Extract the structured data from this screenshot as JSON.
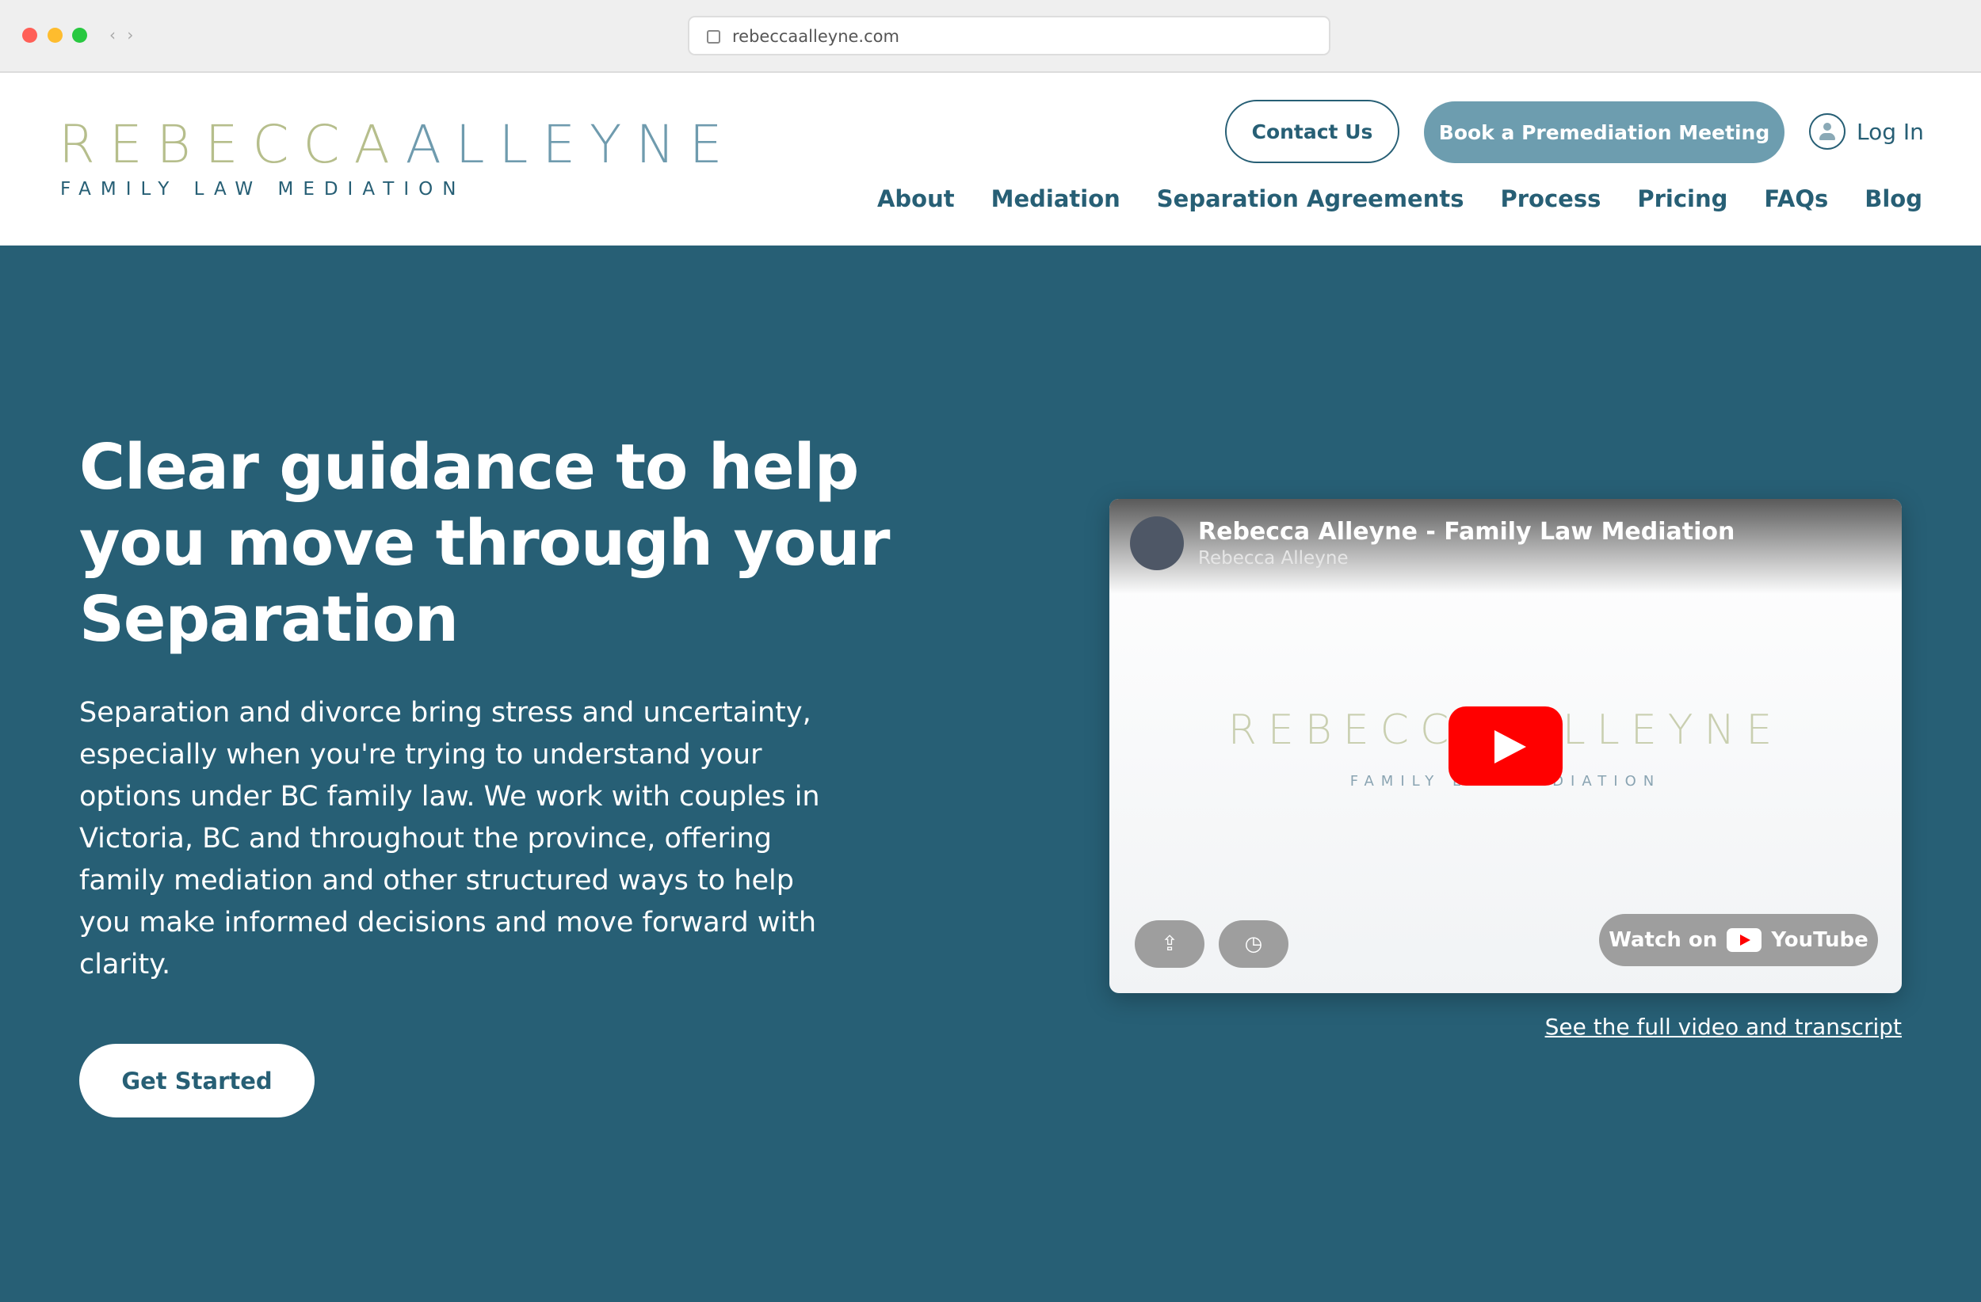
{
  "browser": {
    "url": "rebeccaalleyne.com"
  },
  "header": {
    "logo_first": "REBECCA",
    "logo_second": "ALLEYNE",
    "logo_tagline": "FAMILY LAW MEDIATION",
    "contact_label": "Contact Us",
    "book_label": "Book a Premediation Meeting",
    "login_label": "Log In",
    "nav": [
      "About",
      "Mediation",
      "Separation Agreements",
      "Process",
      "Pricing",
      "FAQs",
      "Blog"
    ]
  },
  "hero": {
    "title": "Clear guidance to help you move through your Separation",
    "body": "Separation and divorce bring stress and uncertainty, especially when you're trying to understand your options under BC family law. We work with couples in Victoria, BC and throughout the province, offering family mediation and other structured ways to help you make informed decisions and move forward with clarity.",
    "cta_label": "Get Started"
  },
  "video": {
    "title": "Rebecca Alleyne - Family Law Mediation",
    "channel": "Rebecca Alleyne",
    "thumb_logo": "REBECCA ALLEYNE",
    "thumb_tagline": "FAMILY LAW MEDIATION",
    "watch_label": "Watch on",
    "youtube_label": "YouTube",
    "transcript_link": "See the full video and transcript"
  },
  "colors": {
    "brand_teal": "#275f75",
    "button_blue": "#6d9daf",
    "logo_green": "#b6be8c",
    "youtube_red": "#ff0000"
  }
}
